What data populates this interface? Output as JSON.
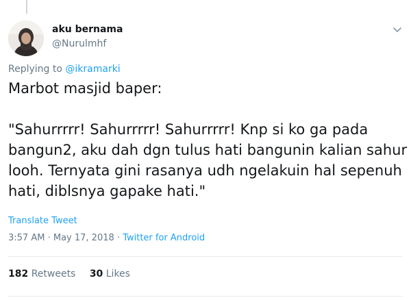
{
  "user": {
    "name": "aku bernama",
    "handle": "@Nurulmhf"
  },
  "reply": {
    "prefix": "Replying to",
    "mention": "@ikramarki"
  },
  "tweet": {
    "lines": [
      "Marbot masjid baper:",
      "",
      "\"Sahurrrrr! Sahurrrrr! Sahurrrrr! Knp si ko ga pada",
      "bangun2, aku dah dgn tulus hati bangunin kalian sahur",
      "looh. Ternyata gini rasanya udh ngelakuin hal sepenuh",
      "hati, diblsnya gapake hati.\""
    ]
  },
  "translate_label": "Translate Tweet",
  "meta": {
    "time": "3:57 AM",
    "date": "May 17, 2018",
    "separator": "·",
    "source": "Twitter for Android"
  },
  "stats": {
    "retweets_count": "182",
    "retweets_label": "Retweets",
    "likes_count": "30",
    "likes_label": "Likes"
  },
  "colors": {
    "link": "#1da1f2",
    "muted": "#657786",
    "text": "#14171a"
  },
  "icons": {
    "menu": "chevron-down-icon",
    "avatar": "avatar-photo"
  }
}
